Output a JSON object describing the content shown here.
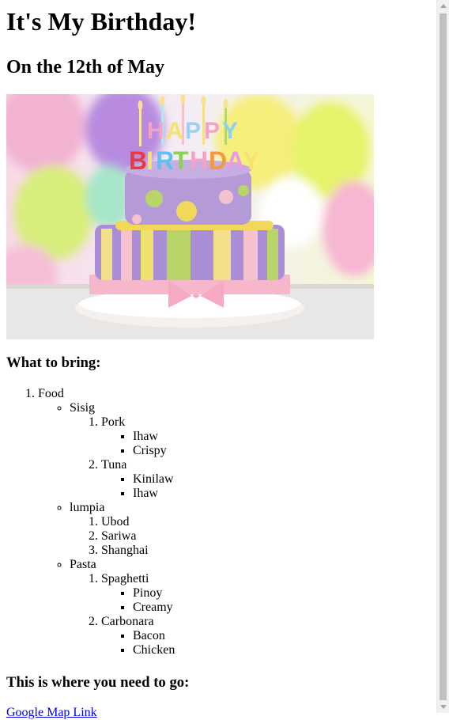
{
  "title": "It's My Birthday!",
  "subtitle": "On the 12th of May",
  "image": {
    "alt": "birthday-cake",
    "lettering": "HAPPY BIRTHDAY"
  },
  "bring_heading": "What to bring:",
  "list": {
    "food": "Food",
    "sisig": "Sisig",
    "pork": "Pork",
    "pork_ihaw": "Ihaw",
    "pork_crispy": "Crispy",
    "tuna": "Tuna",
    "tuna_kinilaw": "Kinilaw",
    "tuna_ihaw": "Ihaw",
    "lumpia": "lumpia",
    "ubod": "Ubod",
    "sariwa": "Sariwa",
    "shanghai": "Shanghai",
    "pasta": "Pasta",
    "spaghetti": "Spaghetti",
    "pinoy": "Pinoy",
    "creamy": "Creamy",
    "carbonara": "Carbonara",
    "bacon": "Bacon",
    "chicken": "Chicken"
  },
  "where_heading": "This is where you need to go:",
  "map_link": "Google Map Link",
  "colors": {
    "link": "#0000ee",
    "scrollbar_thumb": "#c1c1c1"
  }
}
